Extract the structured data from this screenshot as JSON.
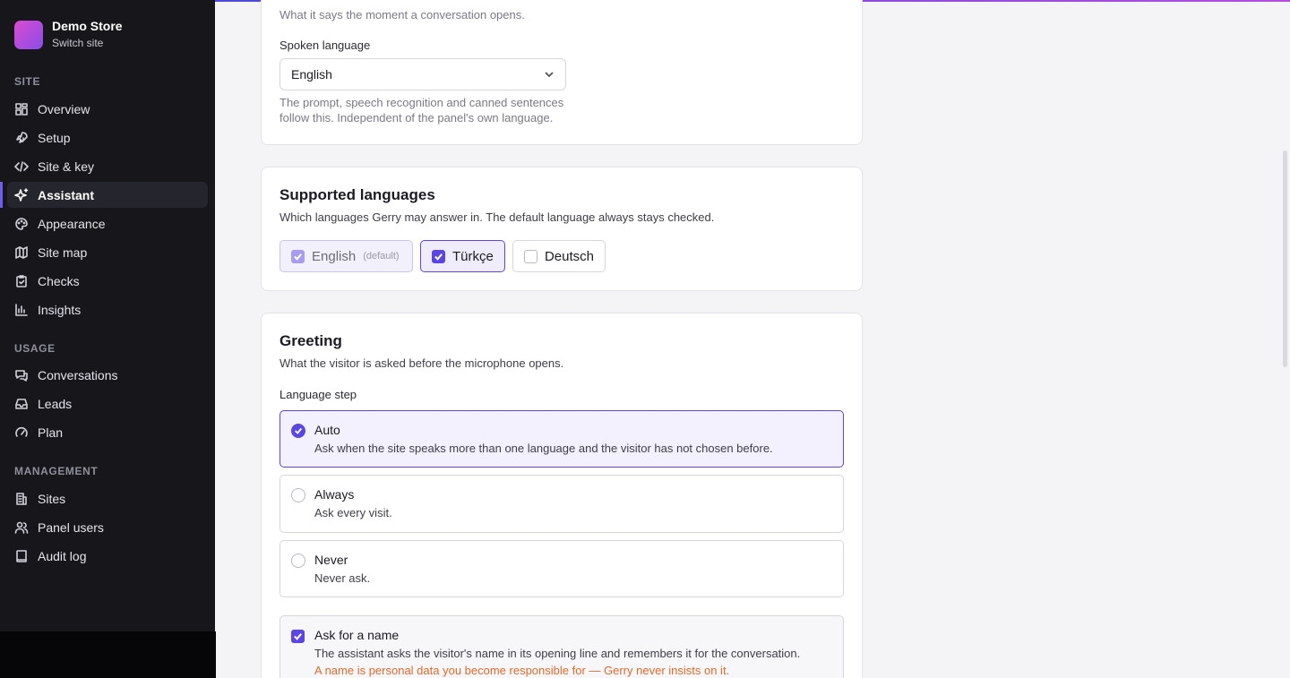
{
  "brand": {
    "name": "Demo Store",
    "switch_label": "Switch site"
  },
  "sidebar": {
    "sections": [
      {
        "label": "SITE"
      },
      {
        "label": "USAGE"
      },
      {
        "label": "MANAGEMENT"
      }
    ],
    "items": [
      {
        "label": "Overview",
        "icon": "grid-icon"
      },
      {
        "label": "Setup",
        "icon": "rocket-icon"
      },
      {
        "label": "Site & key",
        "icon": "code-icon"
      },
      {
        "label": "Assistant",
        "icon": "sparkle-icon",
        "active": true
      },
      {
        "label": "Appearance",
        "icon": "palette-icon"
      },
      {
        "label": "Site map",
        "icon": "map-icon"
      },
      {
        "label": "Checks",
        "icon": "clipboard-check-icon"
      },
      {
        "label": "Insights",
        "icon": "bar-chart-icon"
      },
      {
        "label": "Conversations",
        "icon": "chat-icon"
      },
      {
        "label": "Leads",
        "icon": "inbox-icon"
      },
      {
        "label": "Plan",
        "icon": "gauge-icon"
      },
      {
        "label": "Sites",
        "icon": "building-icon"
      },
      {
        "label": "Panel users",
        "icon": "users-icon"
      },
      {
        "label": "Audit log",
        "icon": "book-icon"
      }
    ]
  },
  "voice": {
    "hint_top": "What it says the moment a conversation opens.",
    "spoken_language_label": "Spoken language",
    "spoken_language_value": "English",
    "spoken_language_help_1": "The prompt, speech recognition and canned sentences",
    "spoken_language_help_2": "follow this. Independent of the panel's own language."
  },
  "supported": {
    "title": "Supported languages",
    "description": "Which languages Gerry may answer in. The default language always stays checked.",
    "languages": [
      {
        "label": "English",
        "tag": "(default)",
        "checked": true
      },
      {
        "label": "Türkçe",
        "checked": true
      },
      {
        "label": "Deutsch",
        "checked": false
      }
    ]
  },
  "greeting": {
    "title": "Greeting",
    "description": "What the visitor is asked before the microphone opens.",
    "language_step_label": "Language step",
    "options": [
      {
        "title": "Auto",
        "description": "Ask when the site speaks more than one language and the visitor has not chosen before.",
        "selected": true
      },
      {
        "title": "Always",
        "description": "Ask every visit.",
        "selected": false
      },
      {
        "title": "Never",
        "description": "Never ask.",
        "selected": false
      }
    ],
    "ask_name": {
      "title": "Ask for a name",
      "description": "The assistant asks the visitor's name in its opening line and remembers it for the conversation.",
      "warning": "A name is personal data you become responsible for — Gerry never insists on it.",
      "checked": true
    }
  },
  "colors": {
    "accent": "#5b46e4",
    "sidebar_bg": "#16161b",
    "warning": "#e06a2c"
  }
}
